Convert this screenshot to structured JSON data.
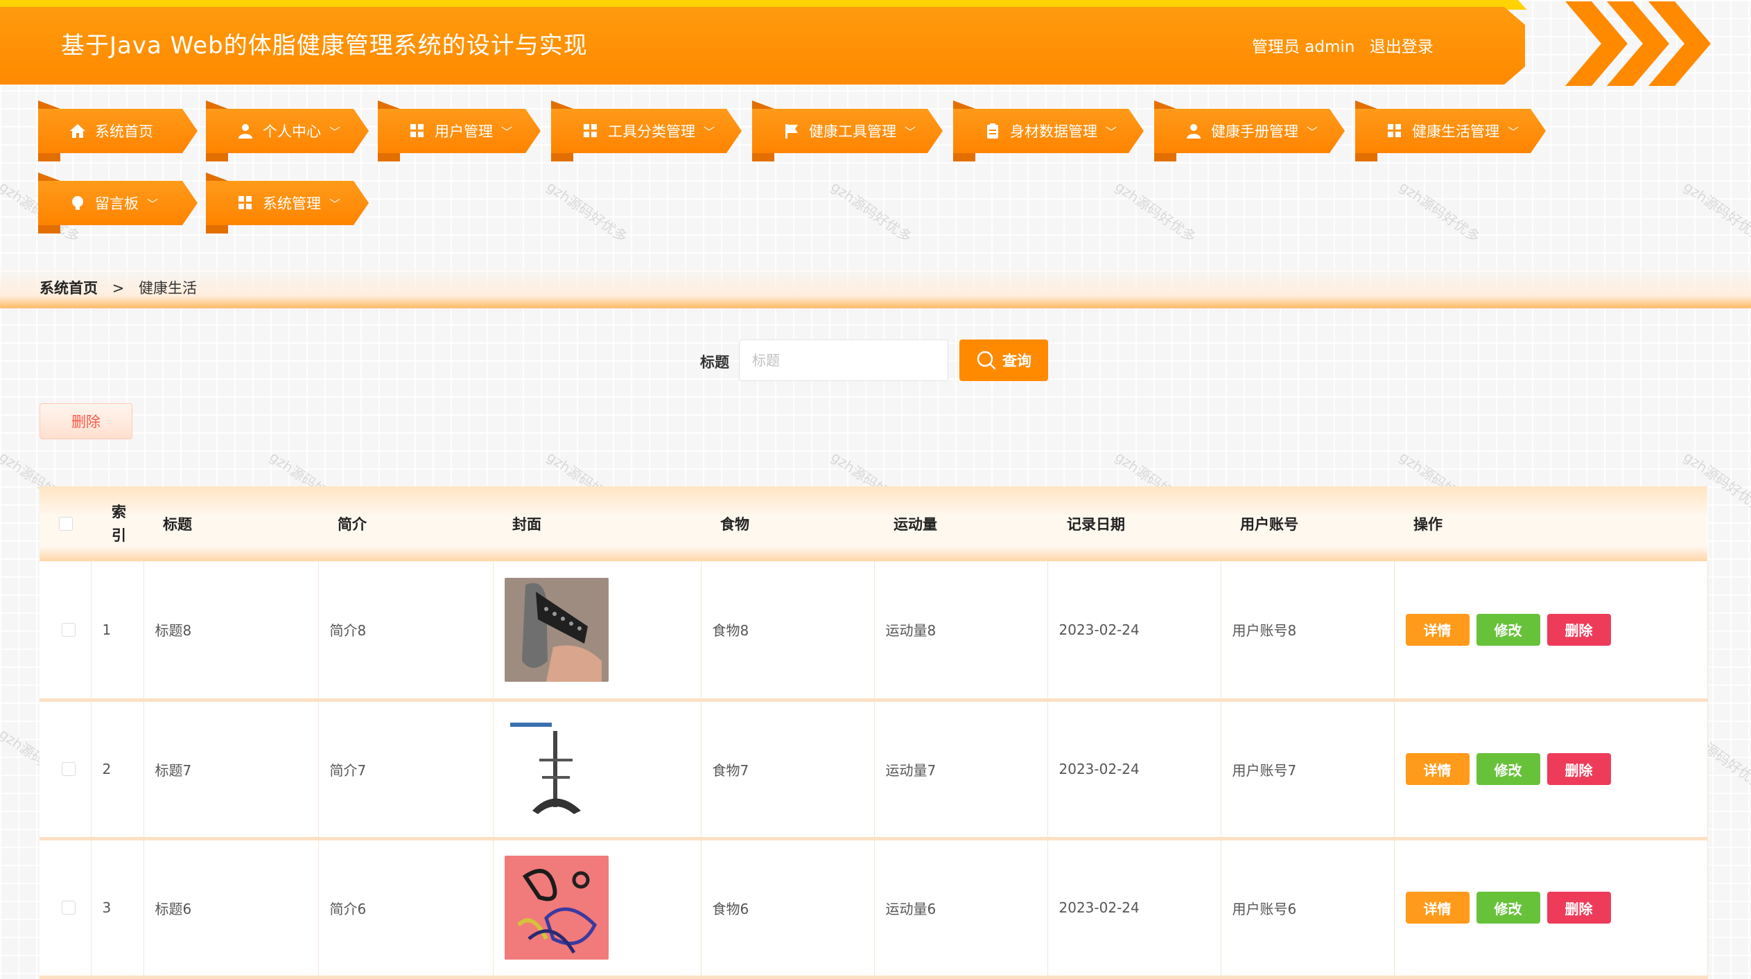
{
  "header": {
    "title": "基于Java Web的体脂健康管理系统的设计与实现",
    "user_label": "管理员 admin",
    "logout_label": "退出登录"
  },
  "nav": {
    "items": [
      {
        "label": "系统首页",
        "icon": "home-icon"
      },
      {
        "label": "个人中心",
        "icon": "user-icon"
      },
      {
        "label": "用户管理",
        "icon": "grid-icon"
      },
      {
        "label": "工具分类管理",
        "icon": "grid-icon"
      },
      {
        "label": "健康工具管理",
        "icon": "flag-icon"
      },
      {
        "label": "身材数据管理",
        "icon": "clipboard-icon"
      },
      {
        "label": "健康手册管理",
        "icon": "user-icon"
      },
      {
        "label": "健康生活管理",
        "icon": "grid-icon"
      },
      {
        "label": "留言板",
        "icon": "bulb-icon"
      },
      {
        "label": "系统管理",
        "icon": "grid-icon"
      }
    ]
  },
  "breadcrumb": {
    "home": "系统首页",
    "separator": ">",
    "current": "健康生活"
  },
  "search": {
    "label": "标题",
    "placeholder": "标题",
    "value": "",
    "button_label": "查询"
  },
  "toolbar": {
    "delete_label": "删除"
  },
  "table": {
    "headers": {
      "index": "索引",
      "title": "标题",
      "intro": "简介",
      "cover": "封面",
      "food": "食物",
      "exercise": "运动量",
      "date": "记录日期",
      "account": "用户账号",
      "actions": "操作"
    },
    "rows": [
      {
        "index": "1",
        "title": "标题8",
        "intro": "简介8",
        "cover": "grip-trainer",
        "food": "食物8",
        "exercise": "运动量8",
        "date": "2023-02-24",
        "account": "用户账号8"
      },
      {
        "index": "2",
        "title": "标题7",
        "intro": "简介7",
        "cover": "stand-rack",
        "food": "食物7",
        "exercise": "运动量7",
        "date": "2023-02-24",
        "account": "用户账号7"
      },
      {
        "index": "3",
        "title": "标题6",
        "intro": "简介6",
        "cover": "resistance-bands",
        "food": "食物6",
        "exercise": "运动量6",
        "date": "2023-02-24",
        "account": "用户账号6"
      }
    ],
    "action_labels": {
      "detail": "详情",
      "edit": "修改",
      "delete": "删除"
    }
  },
  "colors": {
    "primary": "#ff8a00",
    "accent_yellow": "#ffd200",
    "edit_green": "#67c23a",
    "delete_red": "#ef3b5a"
  }
}
